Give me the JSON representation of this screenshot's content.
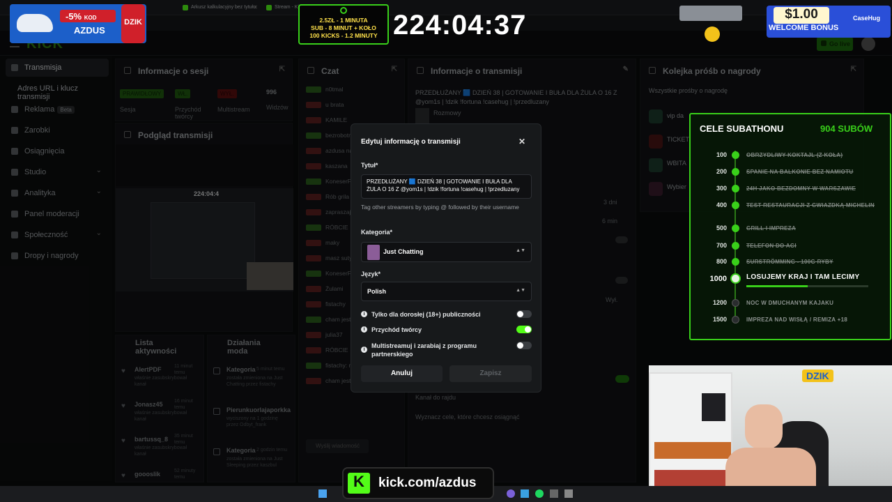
{
  "browser": {
    "tabs": [
      {
        "label": "Arkusz kalkulacyjny bez tytułu"
      },
      {
        "label": "Stream - Kick Dashboard"
      }
    ]
  },
  "promo_left": {
    "discount": "-5%",
    "kod": "KOD",
    "code": "AZDUS",
    "brand": "DZIK"
  },
  "sub_info": {
    "line1": "2.5ZŁ - 1 MINUTA",
    "line2": "SUB - 8 MINUT + KOŁO",
    "line3": "100 KICKS - 1.2 MINUTY"
  },
  "timer": "224:04:37",
  "promo_right": {
    "amount": "$1.00",
    "label": "WELCOME BONUS",
    "brand": "CaseHug"
  },
  "topnav": {
    "logo": "KICK",
    "golive": "Go live"
  },
  "sidebar": {
    "items": [
      {
        "label": "Transmisja"
      },
      {
        "label": "Adres URL i klucz transmisji"
      },
      {
        "label": "Reklama",
        "badge": "Beta"
      },
      {
        "label": "Zarobki"
      },
      {
        "label": "Osiągnięcia"
      },
      {
        "label": "Studio"
      },
      {
        "label": "Analityka"
      },
      {
        "label": "Panel moderacji"
      },
      {
        "label": "Społeczność"
      },
      {
        "label": "Dropy i nagrody"
      }
    ]
  },
  "session": {
    "title": "Informacje o sesji",
    "badges": [
      "PRAWIDŁOWY",
      "WŁ.",
      "WYŁ.",
      "996"
    ],
    "labels": [
      "Sesja",
      "Przychód twórcy",
      "Multistream",
      "Widzów"
    ]
  },
  "preview": {
    "title": "Podgląd transmisji",
    "timer": "224:04:4"
  },
  "chat": {
    "title": "Czat",
    "messages": [
      "n0tmal",
      "u brata",
      "KAMILE",
      "bezrobotny pre",
      "azdusa na mod",
      "kaszana",
      "KoneserFuf",
      "Rób grila Matoh",
      "zapraszaj żul n",
      "RÓBCIE",
      "maky",
      "masz suty",
      "KoneserFuf",
      "Żulami",
      "fistachy",
      "cham jest odpa",
      "julia37",
      "RÓBCIE",
      "fistachy: nowy stop",
      "cham jest"
    ],
    "input_placeholder": "Wyślij wiadomość"
  },
  "stream_info": {
    "title": "Informacje o transmisji",
    "stream_title": "PRZEDŁUŻANY 🟦 DZIEŃ 38 | GOTOWANIE I BUŁA DLA ŻULA O 16 Z @yom1s | !dzik !fortuna !casehug | !przedluzany",
    "category": "Rozmowy",
    "rows": [
      "3 dni",
      "6 min",
      "Wył.",
      "Kanał do rajdu",
      "Wyznacz cele, które chcesz osiągnąć"
    ]
  },
  "rewards": {
    "title": "Kolejka próśb o nagrody",
    "subtitle": "Wszystkie prośby o nagrodę",
    "items": [
      "vip da",
      "TICKET",
      "WBITA",
      "Wybier"
    ]
  },
  "activity": {
    "title": "Lista aktywności",
    "items": [
      {
        "name": "AlertPDF",
        "time": "11 minut temu",
        "desc": "właśnie zasubskrybował kanał"
      },
      {
        "name": "Jonasz45",
        "time": "16 minut temu",
        "desc": "właśnie zasubskrybował kanał"
      },
      {
        "name": "bartussq_8",
        "time": "35 minut temu",
        "desc": "właśnie zasubskrybował kanał"
      },
      {
        "name": "goooslik",
        "time": "52 minuty temu",
        "desc": ""
      }
    ]
  },
  "mod_actions": {
    "title": "Działania moda",
    "items": [
      {
        "name": "Kategoria",
        "time": "5 minut temu",
        "desc": "została zmieniona na Just Chatting przez fistachy"
      },
      {
        "name": "Pierunkuorlajaporkka",
        "time": "",
        "desc": "wyciszony na 1 godzinę przez Odbyt_frank"
      },
      {
        "name": "Kategoria",
        "time": "2 godzin temu",
        "desc": "została zmieniona na Just Sleeping przez kaszbul"
      }
    ]
  },
  "modal": {
    "title": "Edytuj informację o transmisji",
    "title_label": "Tytuł*",
    "title_value": "PRZEDŁUŻANY 🟦 DZIEŃ 38 | GOTOWANIE I BUŁA DLA ŻULA O 16 Z @yom1s | !dzik !fortuna !casehug | !przedluzany",
    "title_hint": "Tag other streamers by typing @ followed by their username",
    "category_label": "Kategoria*",
    "category_value": "Just Chatting",
    "language_label": "Język*",
    "language_value": "Polish",
    "toggles": [
      {
        "label": "Tylko dla dorosłej (18+) publiczności",
        "on": false
      },
      {
        "label": "Przychód twórcy",
        "on": true
      },
      {
        "label": "Multistreamuj i zarabiaj z programu partnerskiego",
        "on": false
      }
    ],
    "cancel_label": "Anuluj",
    "save_label": "Zapisz"
  },
  "subathon": {
    "title": "CELE SUBATHONU",
    "count": "904 SUBÓW",
    "goals": [
      {
        "subs": "100",
        "text": "OBRZYDLIWY KOKTAJL (Z KOŁA)",
        "done": true
      },
      {
        "subs": "200",
        "text": "SPANIE NA BALKONIE BEZ NAMIOTU",
        "done": true
      },
      {
        "subs": "300",
        "text": "24H JAKO BEZDOMNY W WARSZAWIE",
        "done": true
      },
      {
        "subs": "400",
        "text": "TEST RESTAURACJI Z GWIAZDKĄ MICHELIN",
        "done": true
      },
      {
        "subs": "500",
        "text": "GRILL I IMPREZA",
        "done": true
      },
      {
        "subs": "700",
        "text": "TELEFON DO AGI",
        "done": true
      },
      {
        "subs": "800",
        "text": "SURSTRÖMMING - 100G RYBY",
        "done": true
      },
      {
        "subs": "1000",
        "text": "LOSUJEMY KRAJ I TAM LECIMY",
        "done": false,
        "current": true,
        "progress": 0.5
      },
      {
        "subs": "1200",
        "text": "NOC W DMUCHANYM KAJAKU",
        "done": false
      },
      {
        "subs": "1500",
        "text": "IMPREZA NAD WISŁĄ / REMIZA +18",
        "done": false
      }
    ]
  },
  "webcam": {
    "brand": "DZIK"
  },
  "banner": {
    "url": "kick.com/azdus"
  },
  "colors": {
    "kick_green": "#53fc18",
    "subathon_green": "#39d01a",
    "accent_red": "#d0202a",
    "promo_blue": "#1c5fc9"
  }
}
